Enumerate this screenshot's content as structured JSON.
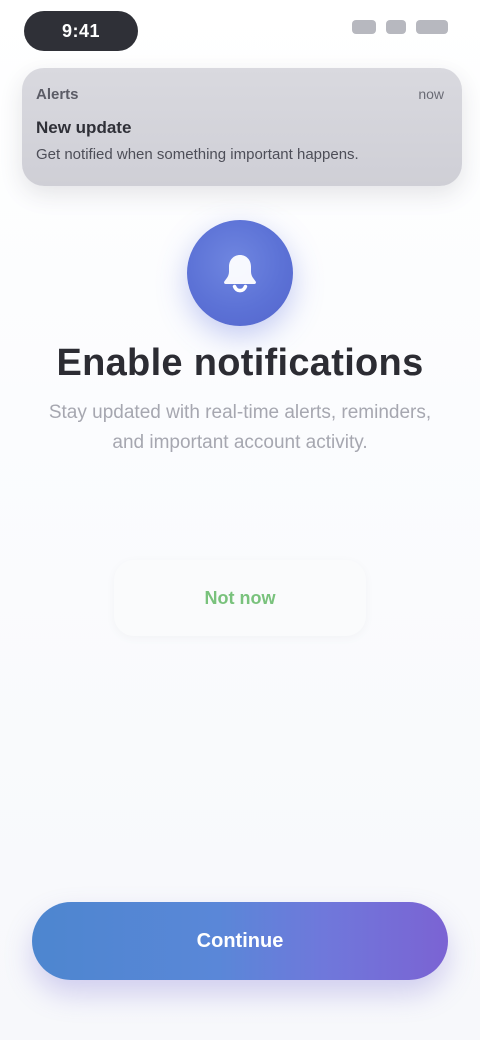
{
  "status_bar": {
    "time": "9:41"
  },
  "preview_notification": {
    "app_name": "Alerts",
    "time": "now",
    "title": "New update",
    "body": "Get notified when something important happens."
  },
  "hero": {
    "icon": "bell-icon",
    "accent_color": "#5C72D6"
  },
  "content": {
    "title": "Enable notifications",
    "description": "Stay updated with real-time alerts, reminders, and important account activity."
  },
  "actions": {
    "secondary_label": "Not now",
    "primary_label": "Continue"
  }
}
